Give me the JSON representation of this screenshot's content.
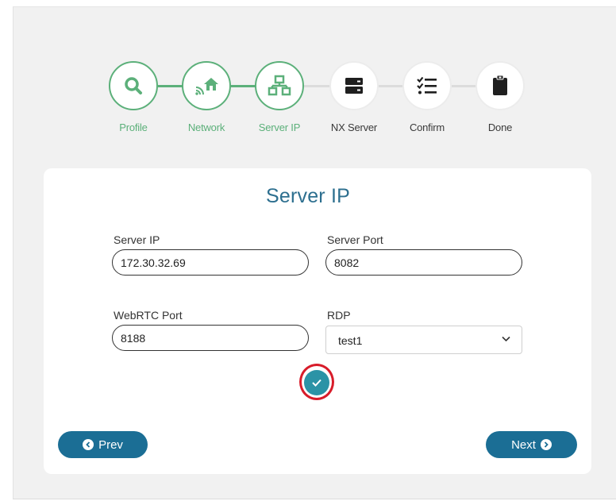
{
  "steps": [
    {
      "label": "Profile",
      "icon": "magnifier-icon",
      "state": "done"
    },
    {
      "label": "Network",
      "icon": "home-network-icon",
      "state": "done"
    },
    {
      "label": "Server IP",
      "icon": "server-network-icon",
      "state": "done"
    },
    {
      "label": "NX Server",
      "icon": "server-icon",
      "state": "pending"
    },
    {
      "label": "Confirm",
      "icon": "checklist-icon",
      "state": "pending"
    },
    {
      "label": "Done",
      "icon": "clipboard-icon",
      "state": "pending"
    }
  ],
  "form": {
    "title": "Server IP",
    "server_ip": {
      "label": "Server IP",
      "value": "172.30.32.69"
    },
    "server_port": {
      "label": "Server Port",
      "value": "8082"
    },
    "webrtc_port": {
      "label": "WebRTC Port",
      "value": "8188"
    },
    "rdp": {
      "label": "RDP",
      "selected": "test1"
    }
  },
  "buttons": {
    "prev_label": "Prev",
    "next_label": "Next"
  },
  "colors": {
    "step_done": "#5cb07a",
    "step_pending": "#dcdcdc",
    "title": "#2d6f8f",
    "nav_button": "#1b6e95",
    "confirm_button": "#2b93a6",
    "highlight_ring": "#d81c2a"
  }
}
